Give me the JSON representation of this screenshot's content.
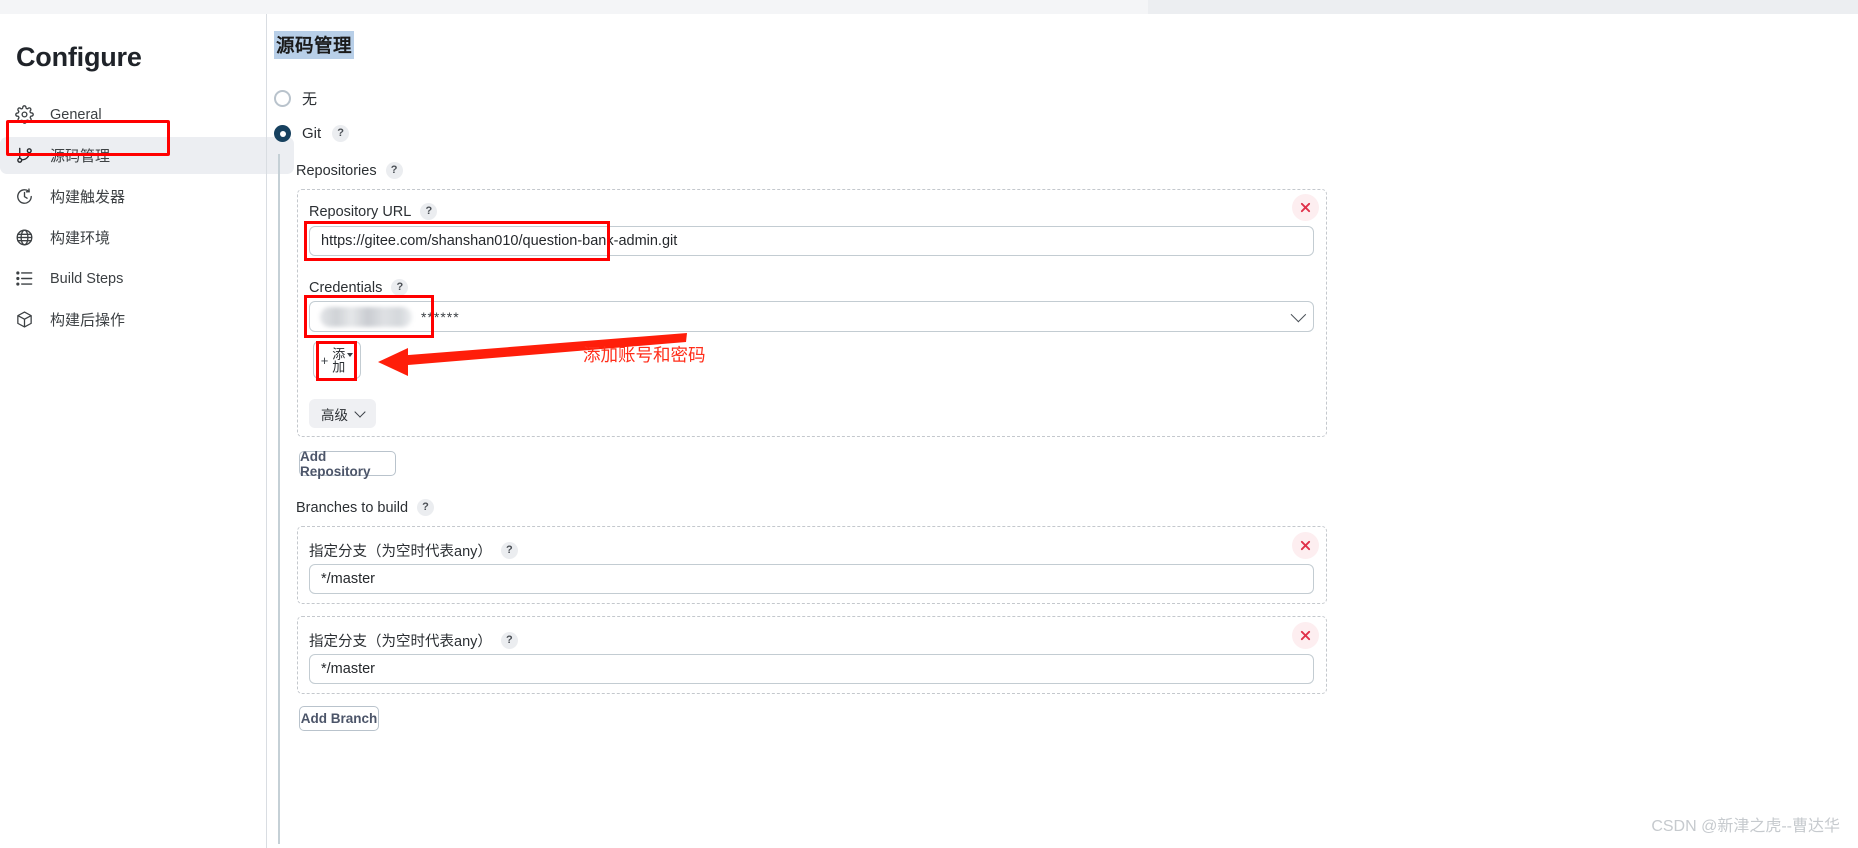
{
  "sidebar": {
    "title": "Configure",
    "items": [
      {
        "icon": "gear-icon",
        "label": "General",
        "active": false
      },
      {
        "icon": "git-branch-icon",
        "label": "源码管理",
        "active": true
      },
      {
        "icon": "clock-icon",
        "label": "构建触发器",
        "active": false
      },
      {
        "icon": "globe-icon",
        "label": "构建环境",
        "active": false
      },
      {
        "icon": "list-steps-icon",
        "label": "Build Steps",
        "active": false
      },
      {
        "icon": "package-icon",
        "label": "构建后操作",
        "active": false
      }
    ]
  },
  "main": {
    "page_title": "源码管理",
    "scm_options": [
      {
        "label": "无",
        "checked": false
      },
      {
        "label": "Git",
        "checked": true,
        "help": "?"
      }
    ],
    "repositories": {
      "label": "Repositories",
      "help": "?",
      "repository_url": {
        "label": "Repository URL",
        "help": "?",
        "value": "https://gitee.com/shanshan010/question-bank-admin.git"
      },
      "credentials": {
        "label": "Credentials",
        "help": "?",
        "value_masked": "******",
        "add_button": {
          "plus": "+",
          "label": "添加",
          "caret": "▾"
        }
      },
      "advanced_button": "高级",
      "delete_button": "×"
    },
    "add_repository_button": "Add Repository",
    "branches": {
      "label": "Branches to build",
      "help": "?",
      "items": [
        {
          "label": "指定分支（为空时代表any）",
          "help": "?",
          "value": "*/master",
          "delete_button": "×"
        },
        {
          "label": "指定分支（为空时代表any）",
          "help": "?",
          "value": "*/master",
          "delete_button": "×"
        }
      ]
    },
    "add_branch_button": "Add Branch"
  },
  "annotations": {
    "credentials_note": "添加账号和密码",
    "accent_red": "#ff0000",
    "note_red": "#ff2d1a"
  },
  "watermark": "CSDN @新津之虎--曹达华"
}
